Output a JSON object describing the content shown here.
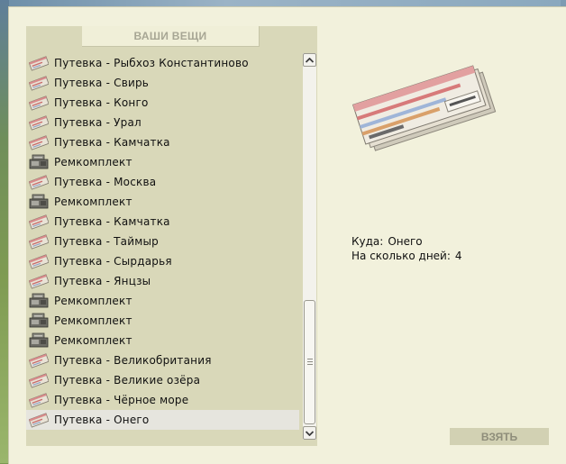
{
  "panel": {
    "title": "ВАШИ ВЕЩИ"
  },
  "items": [
    {
      "label": "Путевка - Рыбхоз Константиново",
      "icon": "ticket-icon"
    },
    {
      "label": "Путевка - Свирь",
      "icon": "ticket-icon"
    },
    {
      "label": "Путевка - Конго",
      "icon": "ticket-icon"
    },
    {
      "label": "Путевка - Урал",
      "icon": "ticket-icon"
    },
    {
      "label": "Путевка - Камчатка",
      "icon": "ticket-icon"
    },
    {
      "label": "Ремкомплект",
      "icon": "repair-kit-icon"
    },
    {
      "label": "Путевка - Москва",
      "icon": "ticket-icon"
    },
    {
      "label": "Ремкомплект",
      "icon": "repair-kit-icon"
    },
    {
      "label": "Путевка - Камчатка",
      "icon": "ticket-icon"
    },
    {
      "label": "Путевка - Таймыр",
      "icon": "ticket-icon"
    },
    {
      "label": "Путевка - Сырдарья",
      "icon": "ticket-icon"
    },
    {
      "label": "Путевка - Янцзы",
      "icon": "ticket-icon"
    },
    {
      "label": "Ремкомплект",
      "icon": "repair-kit-icon"
    },
    {
      "label": "Ремкомплект",
      "icon": "repair-kit-icon"
    },
    {
      "label": "Ремкомплект",
      "icon": "repair-kit-icon"
    },
    {
      "label": "Путевка - Великобритания",
      "icon": "ticket-icon"
    },
    {
      "label": "Путевка - Великие озёра",
      "icon": "ticket-icon"
    },
    {
      "label": "Путевка - Чёрное море",
      "icon": "ticket-icon"
    },
    {
      "label": "Путевка - Онего",
      "icon": "ticket-icon",
      "selected": true
    }
  ],
  "details": {
    "destination_label": "Куда:",
    "destination_value": "Онего",
    "days_label": "На сколько дней:",
    "days_value": "4",
    "preview_icon": "ticket-bundle-icon"
  },
  "actions": {
    "take_label": "ВЗЯТЬ"
  },
  "scrollbar": {
    "up_icon": "scroll-up-arrow-icon",
    "down_icon": "scroll-down-arrow-icon"
  }
}
